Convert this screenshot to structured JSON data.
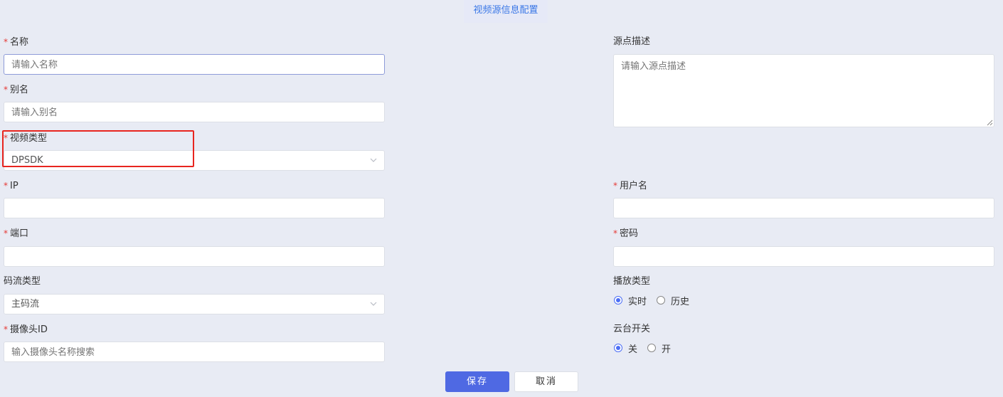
{
  "header": {
    "title": "视频源信息配置"
  },
  "form": {
    "required_mark": "*",
    "name": {
      "label": "名称",
      "placeholder": "请输入名称",
      "required": true
    },
    "alias": {
      "label": "别名",
      "placeholder": "请输入别名",
      "required": true
    },
    "video_type": {
      "label": "视频类型",
      "value": "DPSDK",
      "required": true
    },
    "ip": {
      "label": "IP",
      "value": "",
      "required": true
    },
    "port": {
      "label": "端口",
      "value": "",
      "required": true
    },
    "stream_type": {
      "label": "码流类型",
      "value": "主码流",
      "required": false
    },
    "camera_id": {
      "label": "摄像头ID",
      "placeholder": "输入摄像头名称搜索",
      "required": true
    },
    "description": {
      "label": "源点描述",
      "placeholder": "请输入源点描述",
      "required": false
    },
    "username": {
      "label": "用户名",
      "value": "",
      "required": true
    },
    "password": {
      "label": "密码",
      "value": "",
      "required": true
    },
    "play_type": {
      "label": "播放类型",
      "options": [
        "实时",
        "历史"
      ],
      "selected": "实时"
    },
    "ptz_switch": {
      "label": "云台开关",
      "options": [
        "关",
        "开"
      ],
      "selected": "关"
    }
  },
  "actions": {
    "save_label": "保存",
    "cancel_label": "取消"
  },
  "colors": {
    "accent": "#4f69e3",
    "required": "#e53935",
    "highlight": "#e8251f",
    "background": "#e8ebf4"
  }
}
